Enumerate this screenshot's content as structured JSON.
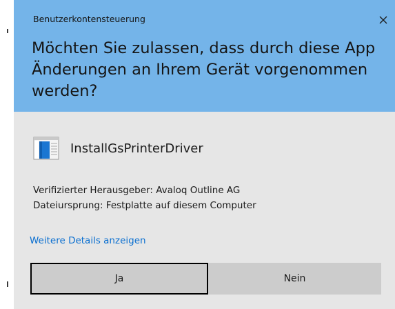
{
  "dialog": {
    "caption": "Benutzerkontensteuerung",
    "close_icon": "close-icon",
    "question": "Möchten Sie zulassen, dass durch diese App Änderungen an Ihrem Gerät vorgenommen werden?",
    "header_color": "#74b4e9",
    "body_color": "#e6e6e6"
  },
  "app": {
    "icon": "application-window-icon",
    "name": "InstallGsPrinterDriver"
  },
  "info": {
    "publisher": "Verifizierter Herausgeber: Avaloq Outline AG",
    "origin": "Dateiursprung: Festplatte auf diesem Computer"
  },
  "details_link": {
    "label": "Weitere Details anzeigen",
    "color": "#0a6fd0"
  },
  "buttons": {
    "yes": "Ja",
    "no": "Nein"
  }
}
